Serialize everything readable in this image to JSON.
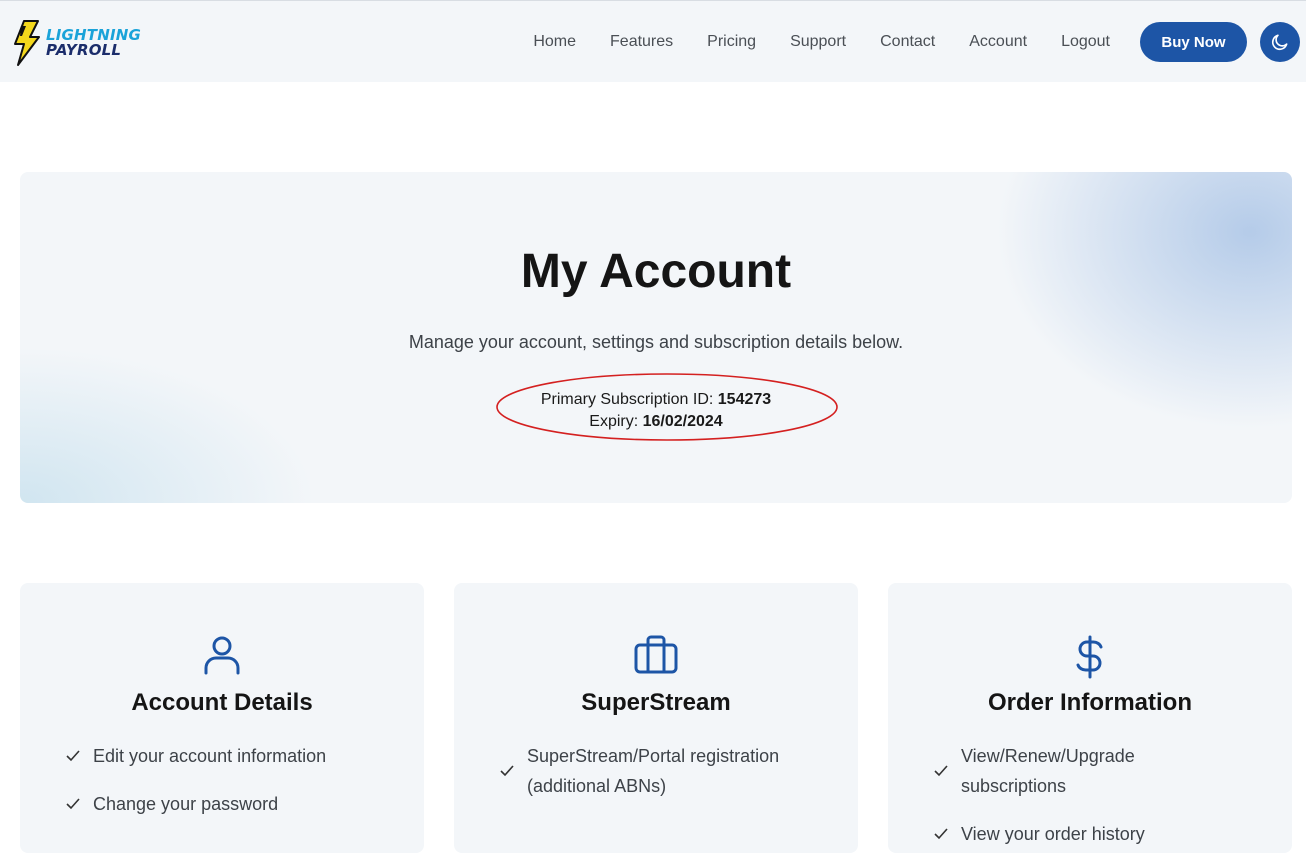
{
  "brand": {
    "line1": "LIGHTNING",
    "line2": "PAYROLL",
    "colors": {
      "cyan": "#1aa3d9",
      "navy": "#1b2d6b",
      "bolt": "#f4d81c"
    }
  },
  "nav": {
    "links": [
      "Home",
      "Features",
      "Pricing",
      "Support",
      "Contact",
      "Account",
      "Logout"
    ],
    "buy_label": "Buy Now",
    "theme_icon": "moon-icon",
    "accent": "#1d55a6"
  },
  "hero": {
    "title": "My Account",
    "subtitle": "Manage your account, settings and subscription details below.",
    "subscription_label": "Primary Subscription ID: ",
    "subscription_id": "154273",
    "expiry_label": "Expiry: ",
    "expiry_date": "16/02/2024",
    "annotation_color": "#d42020"
  },
  "cards": [
    {
      "icon": "user-icon",
      "title": "Account Details",
      "items": [
        "Edit your account information",
        "Change your password"
      ]
    },
    {
      "icon": "briefcase-icon",
      "title": "SuperStream",
      "items": [
        "SuperStream/Portal registration (additional ABNs)"
      ]
    },
    {
      "icon": "dollar-icon",
      "title": "Order Information",
      "items": [
        "View/Renew/Upgrade subscriptions",
        "View your order history"
      ]
    }
  ]
}
